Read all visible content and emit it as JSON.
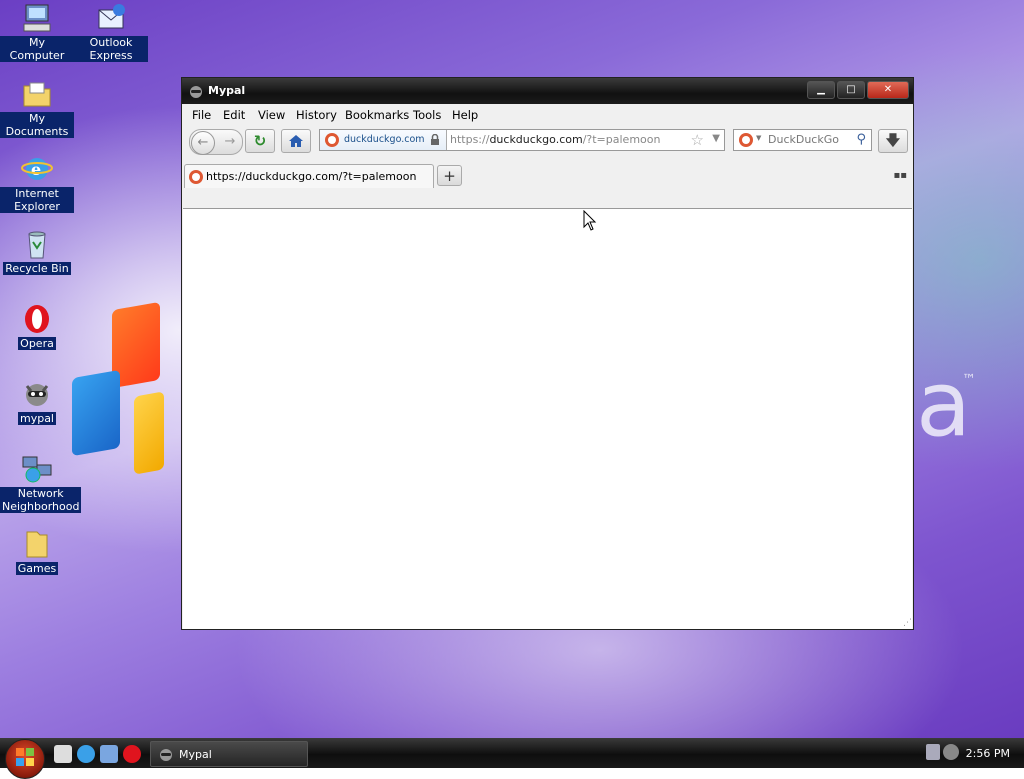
{
  "desktop": {
    "icons": [
      {
        "label": "My Computer",
        "icon": "computer-icon"
      },
      {
        "label": "Outlook Express",
        "icon": "outlook-express-icon"
      },
      {
        "label": "My Documents",
        "icon": "folder-documents-icon"
      },
      {
        "label": "Internet Explorer",
        "icon": "internet-explorer-icon"
      },
      {
        "label": "Recycle Bin",
        "icon": "recycle-bin-icon"
      },
      {
        "label": "Opera",
        "icon": "opera-icon"
      },
      {
        "label": "mypal",
        "icon": "mypal-raccoon-icon"
      },
      {
        "label": "Network Neighborhood",
        "icon": "network-icon"
      },
      {
        "label": "Games",
        "icon": "folder-icon"
      }
    ]
  },
  "window": {
    "title": "Mypal",
    "controls": {
      "minimize": "minimize-icon",
      "maximize": "maximize-icon",
      "close": "close-icon"
    }
  },
  "menubar": {
    "items": [
      "File",
      "Edit",
      "View",
      "History",
      "Bookmarks",
      "Tools",
      "Help"
    ]
  },
  "navbar": {
    "identity_site": "duckduckgo.com",
    "url_prefix": "https://",
    "url_host": "duckduckgo.com",
    "url_rest": "/?t=palemoon",
    "search_placeholder": "DuckDuckGo"
  },
  "tabs": [
    {
      "title": "https://duckduckgo.com/?t=palemoon",
      "active": true
    }
  ],
  "colors": {
    "ddg_orange": "#de5833",
    "selection_blue": "#0a246a",
    "home_blue": "#2a5db0",
    "reload_green": "#2e8b2e"
  },
  "taskbar": {
    "task_label": "Mypal",
    "clock": "2:56 PM"
  }
}
